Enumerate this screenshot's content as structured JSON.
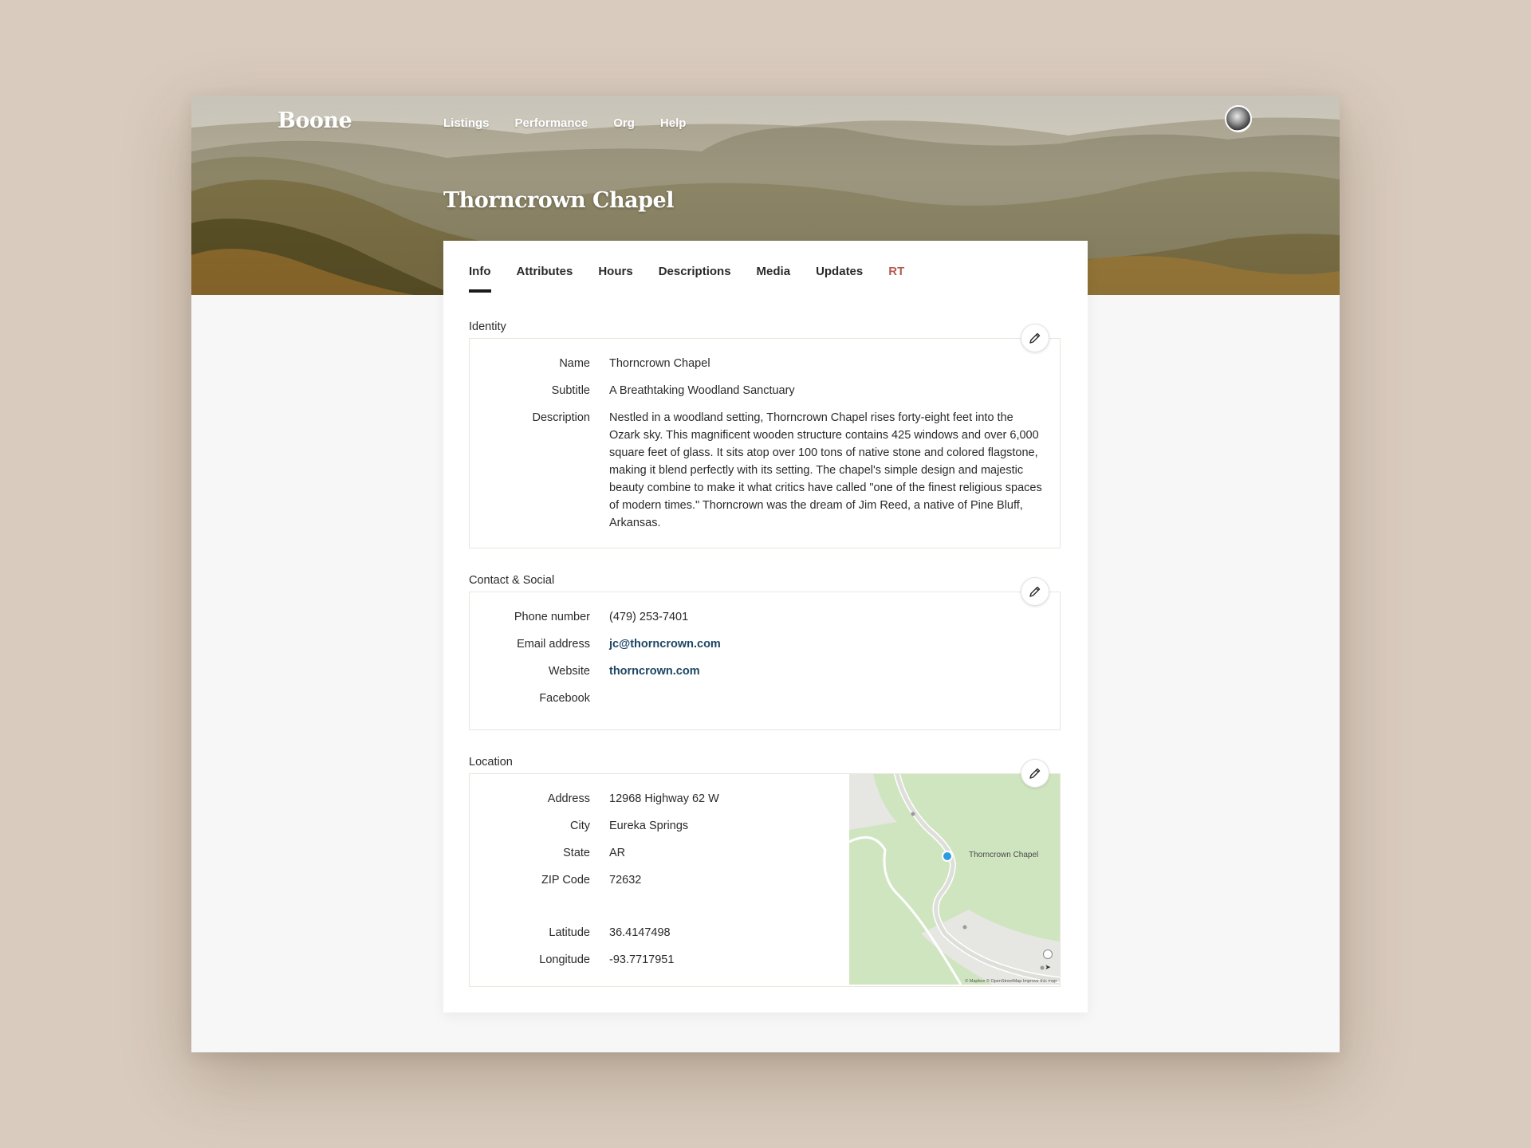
{
  "app": {
    "logo": "Boone",
    "nav": [
      "Listings",
      "Performance",
      "Org",
      "Help"
    ]
  },
  "page": {
    "title": "Thorncrown Chapel"
  },
  "tabs": [
    "Info",
    "Attributes",
    "Hours",
    "Descriptions",
    "Media",
    "Updates",
    "RT"
  ],
  "identity": {
    "section_title": "Identity",
    "name_label": "Name",
    "name": "Thorncrown Chapel",
    "subtitle_label": "Subtitle",
    "subtitle": "A Breathtaking Woodland Sanctuary",
    "description_label": "Description",
    "description": "Nestled in a woodland setting, Thorncrown Chapel rises forty-eight feet into the Ozark sky. This magnificent wooden structure contains 425 windows and over 6,000 square feet of glass. It sits atop over 100 tons of native stone and colored flagstone, making it blend perfectly with its setting. The chapel's simple design and majestic beauty combine to make it what critics have called \"one of the finest religious spaces of modern times.\" Thorncrown was the dream of Jim Reed, a native of Pine Bluff, Arkansas."
  },
  "contact": {
    "section_title": "Contact & Social",
    "phone_label": "Phone number",
    "phone": "(479) 253-7401",
    "email_label": "Email address",
    "email": "jc@thorncrown.com",
    "website_label": "Website",
    "website": "thorncrown.com",
    "facebook_label": "Facebook",
    "facebook": ""
  },
  "location": {
    "section_title": "Location",
    "address_label": "Address",
    "address": "12968 Highway 62 W",
    "city_label": "City",
    "city": "Eureka Springs",
    "state_label": "State",
    "state": "AR",
    "zip_label": "ZIP Code",
    "zip": "72632",
    "lat_label": "Latitude",
    "latitude": "36.4147498",
    "lng_label": "Longitude",
    "longitude": "-93.7717951",
    "map_marker_label": "Thorncrown Chapel",
    "map_attribution": "© Mapbox © OpenStreetMap Improve this map"
  },
  "icons": {
    "edit": "pencil-icon",
    "map_marker": "map-pin-icon",
    "compass": "compass-icon",
    "locate": "locate-arrow-icon"
  },
  "colors": {
    "link": "#1c4664",
    "rt_tab": "#b35b4c",
    "map_land": "#cfe5bf",
    "map_road": "#dededb"
  }
}
